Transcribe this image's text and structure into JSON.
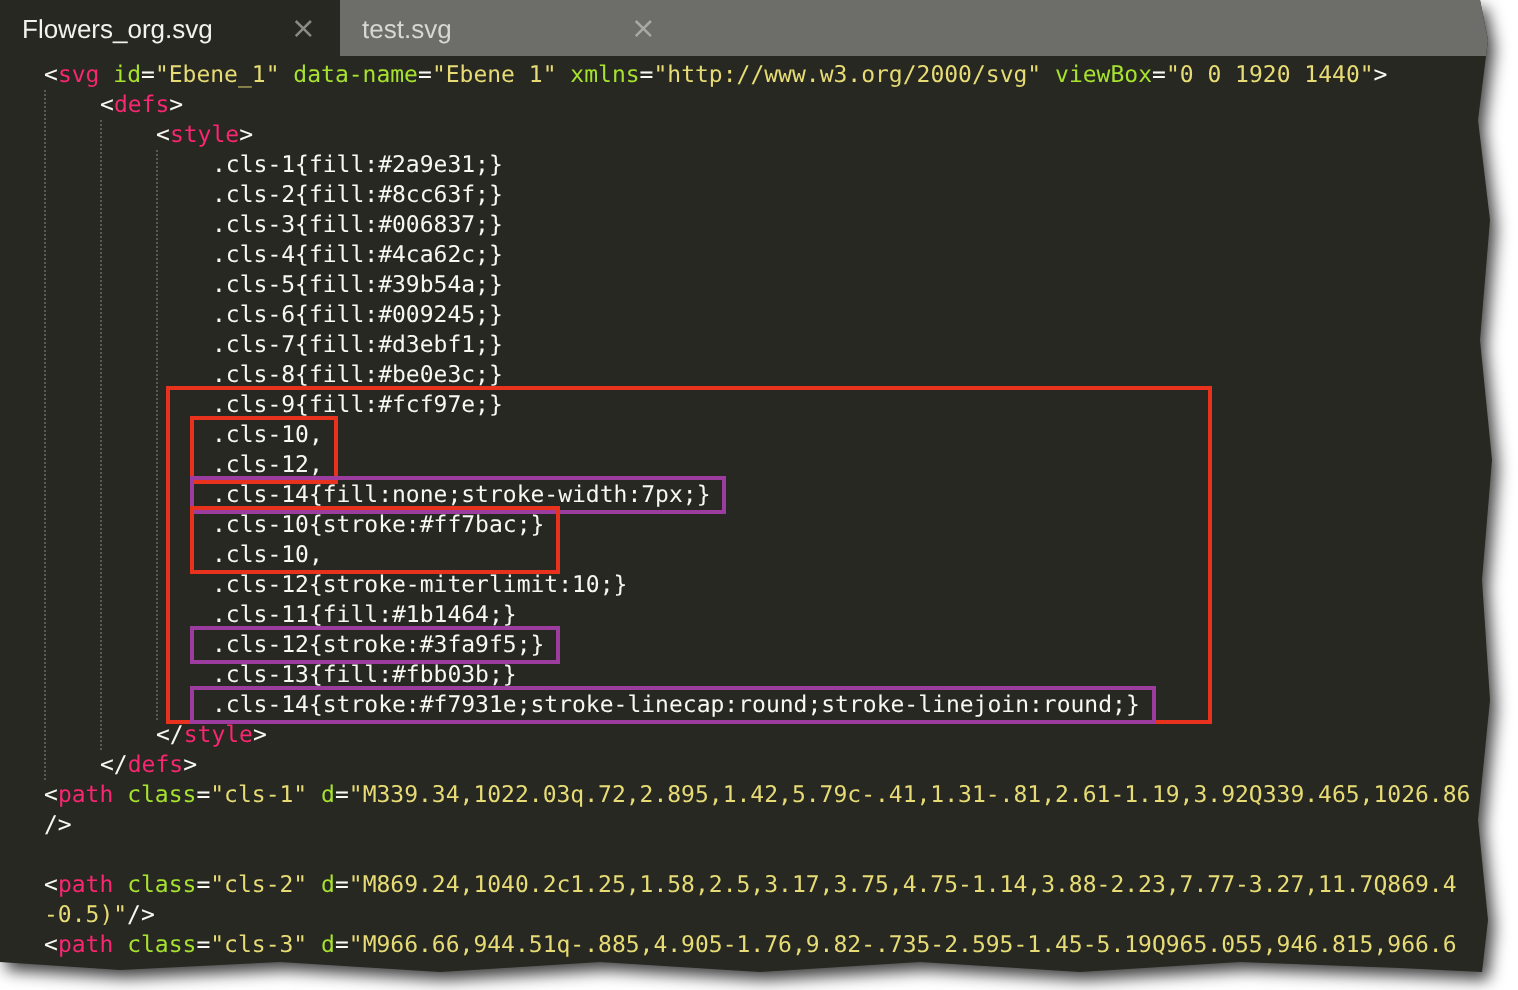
{
  "tabs": [
    {
      "label": "Flowers_org.svg",
      "close": "×",
      "selected": true
    },
    {
      "label": "test.svg",
      "close": "×",
      "selected": false
    }
  ],
  "code": [
    {
      "kind": "line",
      "tokens": [
        {
          "kind": "plain",
          "text": "<"
        },
        {
          "kind": "tag",
          "text": "svg"
        },
        {
          "kind": "attr",
          "text": " id"
        },
        {
          "kind": "plain",
          "text": "="
        },
        {
          "kind": "string",
          "text": "\"Ebene_1\""
        },
        {
          "kind": "attr",
          "text": " data-name"
        },
        {
          "kind": "plain",
          "text": "="
        },
        {
          "kind": "string",
          "text": "\"Ebene 1\""
        },
        {
          "kind": "attr",
          "text": " xmlns"
        },
        {
          "kind": "plain",
          "text": "="
        },
        {
          "kind": "string",
          "text": "\"http://www.w3.org/2000/svg\""
        },
        {
          "kind": "attr",
          "text": " viewBox"
        },
        {
          "kind": "plain",
          "text": "="
        },
        {
          "kind": "string",
          "text": "\"0 0 1920 1440\""
        },
        {
          "kind": "plain",
          "text": ">"
        }
      ],
      "children": [
        {
          "kind": "line",
          "tokens": [
            {
              "kind": "plain",
              "text": "<"
            },
            {
              "kind": "tag",
              "text": "defs"
            },
            {
              "kind": "plain",
              "text": ">"
            }
          ],
          "children": [
            {
              "kind": "line",
              "tokens": [
                {
                  "kind": "plain",
                  "text": "<"
                },
                {
                  "kind": "tag",
                  "text": "style"
                },
                {
                  "kind": "plain",
                  "text": ">"
                }
              ],
              "children": [
                {
                  "kind": "line",
                  "tokens": [
                    {
                      "kind": "plain",
                      "text": ".cls-1{fill:#2a9e31;}"
                    }
                  ]
                },
                {
                  "kind": "line",
                  "tokens": [
                    {
                      "kind": "plain",
                      "text": ".cls-2{fill:#8cc63f;}"
                    }
                  ]
                },
                {
                  "kind": "line",
                  "tokens": [
                    {
                      "kind": "plain",
                      "text": ".cls-3{fill:#006837;}"
                    }
                  ]
                },
                {
                  "kind": "line",
                  "tokens": [
                    {
                      "kind": "plain",
                      "text": ".cls-4{fill:#4ca62c;}"
                    }
                  ]
                },
                {
                  "kind": "line",
                  "tokens": [
                    {
                      "kind": "plain",
                      "text": ".cls-5{fill:#39b54a;}"
                    }
                  ]
                },
                {
                  "kind": "line",
                  "tokens": [
                    {
                      "kind": "plain",
                      "text": ".cls-6{fill:#009245;}"
                    }
                  ]
                },
                {
                  "kind": "line",
                  "tokens": [
                    {
                      "kind": "plain",
                      "text": ".cls-7{fill:#d3ebf1;}"
                    }
                  ]
                },
                {
                  "kind": "line",
                  "tokens": [
                    {
                      "kind": "plain",
                      "text": ".cls-8{fill:#be0e3c;}"
                    }
                  ]
                },
                {
                  "kind": "box",
                  "color": "#e8321e",
                  "children": [
                    {
                      "kind": "line",
                      "tokens": [
                        {
                          "kind": "plain",
                          "text": ".cls-9{fill:#fcf97e;}"
                        }
                      ]
                    },
                    {
                      "kind": "box",
                      "color": "#e8321e",
                      "children": [
                        {
                          "kind": "line",
                          "tokens": [
                            {
                              "kind": "plain",
                              "text": ".cls-10,"
                            }
                          ]
                        },
                        {
                          "kind": "line",
                          "tokens": [
                            {
                              "kind": "plain",
                              "text": ".cls-12,"
                            }
                          ]
                        }
                      ]
                    },
                    {
                      "kind": "box",
                      "color": "#9b3c9e",
                      "children": [
                        {
                          "kind": "line",
                          "tokens": [
                            {
                              "kind": "plain",
                              "text": ".cls-14{fill:none;stroke-width:7px;}"
                            }
                          ]
                        }
                      ]
                    },
                    {
                      "kind": "box",
                      "color": "#e8321e",
                      "children": [
                        {
                          "kind": "line",
                          "tokens": [
                            {
                              "kind": "plain",
                              "text": ".cls-10{stroke:#ff7bac;}"
                            }
                          ]
                        },
                        {
                          "kind": "line",
                          "tokens": [
                            {
                              "kind": "plain",
                              "text": ".cls-10,"
                            }
                          ]
                        }
                      ]
                    },
                    {
                      "kind": "line",
                      "tokens": [
                        {
                          "kind": "plain",
                          "text": ".cls-12{stroke-miterlimit:10;}"
                        }
                      ]
                    },
                    {
                      "kind": "line",
                      "tokens": [
                        {
                          "kind": "plain",
                          "text": ".cls-11{fill:#1b1464;}"
                        }
                      ]
                    },
                    {
                      "kind": "box",
                      "color": "#9b3c9e",
                      "children": [
                        {
                          "kind": "line",
                          "tokens": [
                            {
                              "kind": "plain",
                              "text": ".cls-12{stroke:#3fa9f5;}"
                            }
                          ]
                        }
                      ]
                    },
                    {
                      "kind": "line",
                      "tokens": [
                        {
                          "kind": "plain",
                          "text": ".cls-13{fill:#fbb03b;}"
                        }
                      ]
                    },
                    {
                      "kind": "box",
                      "color": "#9b3c9e",
                      "children": [
                        {
                          "kind": "line",
                          "tokens": [
                            {
                              "kind": "plain",
                              "text": ".cls-14{stroke:#f7931e;stroke-linecap:round;stroke-linejoin:round;}"
                            }
                          ]
                        }
                      ]
                    }
                  ]
                }
              ]
            },
            {
              "kind": "line",
              "tokens": [
                {
                  "kind": "plain",
                  "text": "</"
                },
                {
                  "kind": "tag",
                  "text": "style"
                },
                {
                  "kind": "plain",
                  "text": ">"
                }
              ]
            }
          ]
        },
        {
          "kind": "line",
          "tokens": [
            {
              "kind": "plain",
              "text": "</"
            },
            {
              "kind": "tag",
              "text": "defs"
            },
            {
              "kind": "plain",
              "text": ">"
            }
          ]
        }
      ]
    },
    {
      "kind": "line",
      "tokens": [
        {
          "kind": "plain",
          "text": "<"
        },
        {
          "kind": "tag",
          "text": "path"
        },
        {
          "kind": "attr",
          "text": " class"
        },
        {
          "kind": "plain",
          "text": "="
        },
        {
          "kind": "string",
          "text": "\"cls-1\""
        },
        {
          "kind": "attr",
          "text": " d"
        },
        {
          "kind": "plain",
          "text": "="
        },
        {
          "kind": "string",
          "text": "\"M339.34,1022.03q.72,2.895,1.42,5.79c-.41,1.31-.81,2.61-1.19,3.92Q339.465,1026.86"
        }
      ]
    },
    {
      "kind": "line",
      "tokens": [
        {
          "kind": "plain",
          "text": "/>"
        }
      ]
    },
    {
      "kind": "blank"
    },
    {
      "kind": "line",
      "tokens": [
        {
          "kind": "plain",
          "text": "<"
        },
        {
          "kind": "tag",
          "text": "path"
        },
        {
          "kind": "attr",
          "text": " class"
        },
        {
          "kind": "plain",
          "text": "="
        },
        {
          "kind": "string",
          "text": "\"cls-2\""
        },
        {
          "kind": "attr",
          "text": " d"
        },
        {
          "kind": "plain",
          "text": "="
        },
        {
          "kind": "string",
          "text": "\"M869.24,1040.2c1.25,1.58,2.5,3.17,3.75,4.75-1.14,3.88-2.23,7.77-3.27,11.7Q869.4"
        }
      ]
    },
    {
      "kind": "line",
      "tokens": [
        {
          "kind": "string",
          "text": "-0.5)\""
        },
        {
          "kind": "plain",
          "text": "/>"
        }
      ]
    },
    {
      "kind": "line",
      "tokens": [
        {
          "kind": "plain",
          "text": "<"
        },
        {
          "kind": "tag",
          "text": "path"
        },
        {
          "kind": "attr",
          "text": " class"
        },
        {
          "kind": "plain",
          "text": "="
        },
        {
          "kind": "string",
          "text": "\"cls-3\""
        },
        {
          "kind": "attr",
          "text": " d"
        },
        {
          "kind": "plain",
          "text": "="
        },
        {
          "kind": "string",
          "text": "\"M966.66,944.51q-.885,4.905-1.76,9.82-.735-2.595-1.45-5.19Q965.055,946.815,966.6"
        }
      ]
    }
  ]
}
